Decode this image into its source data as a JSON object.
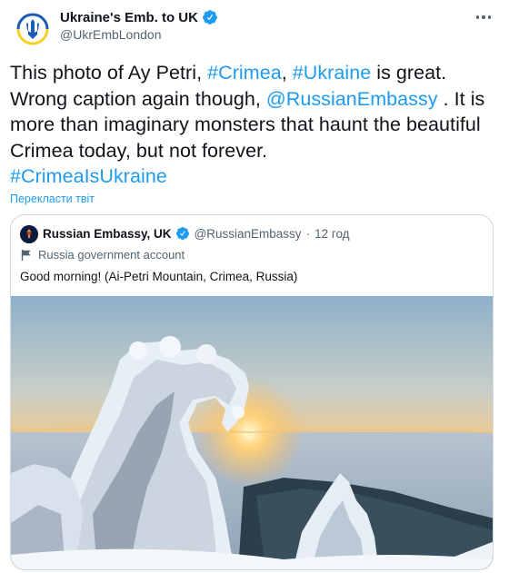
{
  "author": {
    "display_name": "Ukraine's Emb. to UK",
    "handle": "@UkrEmbLondon"
  },
  "tweet": {
    "part1": "This photo of Ay Petri, ",
    "hashtag_crimea": "#Crimea",
    "sep1": ", ",
    "hashtag_ukraine": "#Ukraine",
    "part2": " is great. Wrong caption again though, ",
    "mention": "@RussianEmbassy",
    "part3": " . It is more than imaginary monsters that haunt the beautiful Crimea today, but not forever.",
    "hashtag_crimea_is_ukraine": "#CrimeaIsUkraine"
  },
  "translate_label": "Перекласти твіт",
  "quoted": {
    "display_name": "Russian Embassy, UK",
    "handle": "@RussianEmbassy",
    "separator": "·",
    "time": "12 год",
    "label": "Russia government account",
    "text": "Good morning! (Ai-Petri Mountain, Crimea, Russia)"
  },
  "colors": {
    "link": "#1d9bf0",
    "text": "#0f1419",
    "secondary": "#536471",
    "border": "#cfd9de"
  },
  "icons": {
    "verified": "verified-badge-icon",
    "more": "more-options-icon",
    "flag": "government-flag-icon"
  }
}
